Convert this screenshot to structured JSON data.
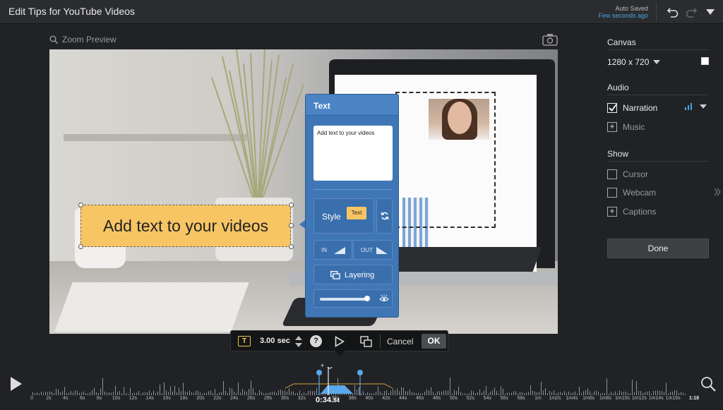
{
  "window": {
    "title": "Edit Tips for YouTube Videos",
    "autosave_status": "Auto Saved",
    "autosave_time": "Few seconds ago"
  },
  "preview": {
    "zoom_label": "Zoom Preview"
  },
  "callout": {
    "text": "Add text to your videos"
  },
  "text_panel": {
    "title": "Text",
    "input_value": "Add text to your videos",
    "style_label": "Style",
    "style_swatch_label": "Text",
    "in_label": "IN",
    "out_label": "OUT",
    "layering_label": "Layering",
    "opacity": 0.95
  },
  "bottom_toolbar": {
    "text_icon": "T",
    "duration": "3.00 sec",
    "help": "?",
    "cancel_label": "Cancel",
    "ok_label": "OK"
  },
  "sidebar": {
    "canvas": {
      "title": "Canvas",
      "size": "1280 x 720"
    },
    "audio": {
      "title": "Audio",
      "narration": {
        "label": "Narration",
        "checked": true
      },
      "music": {
        "label": "Music"
      }
    },
    "show": {
      "title": "Show",
      "cursor": {
        "label": "Cursor",
        "checked": false
      },
      "webcam": {
        "label": "Webcam",
        "checked": false
      },
      "captions": {
        "label": "Captions"
      }
    },
    "done_label": "Done"
  },
  "timeline": {
    "current_time_main": "0:34.",
    "current_time_frac": "84",
    "end_time": "1:18",
    "ticks": [
      "0",
      "2s",
      "4s",
      "6s",
      "8s",
      "10s",
      "12s",
      "14s",
      "16s",
      "18s",
      "20s",
      "22s",
      "24s",
      "26s",
      "28s",
      "30s",
      "32s",
      "",
      "36s",
      "38s",
      "40s",
      "42s",
      "44s",
      "46s",
      "48s",
      "50s",
      "52s",
      "54s",
      "56s",
      "58s",
      "1m",
      "1m2s",
      "1m4s",
      "1m6s",
      "1m8s",
      "1m10s",
      "1m12s",
      "1m14s",
      "1m16s"
    ],
    "add_marker": "+"
  },
  "colors": {
    "accent_blue": "#4aa3df",
    "callout_yellow": "#f8c564",
    "panel_blue": "#3f77b6"
  }
}
